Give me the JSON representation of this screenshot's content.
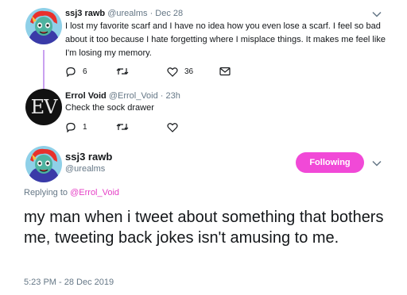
{
  "tweets": [
    {
      "name": "ssj3 rawb",
      "handle": "@urealms",
      "date": "Dec 28",
      "text": "I lost my favorite scarf and I have no idea how you even lose a scarf. I feel so bad about it too because I hate forgetting where I misplace things. It makes me feel like I'm losing my memory.",
      "replies": "6",
      "retweets": "",
      "likes": "36"
    },
    {
      "name": "Errol Void",
      "handle": "@Errol_Void",
      "date": "23h",
      "text": "Check the sock drawer",
      "avatar_text": "EV",
      "replies": "1",
      "retweets": "",
      "likes": ""
    }
  ],
  "main": {
    "name": "ssj3 rawb",
    "handle": "@urealms",
    "follow_label": "Following",
    "replying_prefix": "Replying to",
    "replying_to": "@Errol_Void",
    "text": "my man when i tweet about something that bothers me, tweeting back jokes isn't amusing to me.",
    "timestamp": "5:23 PM - 28 Dec 2019"
  },
  "separator": "·",
  "colors": {
    "accent": "#f149d7",
    "link": "#e53fc6",
    "muted": "#657786",
    "thread_line": "#c9a1f0"
  },
  "icons": [
    "reply-icon",
    "retweet-icon",
    "like-icon",
    "message-icon",
    "chevron-down-icon"
  ]
}
